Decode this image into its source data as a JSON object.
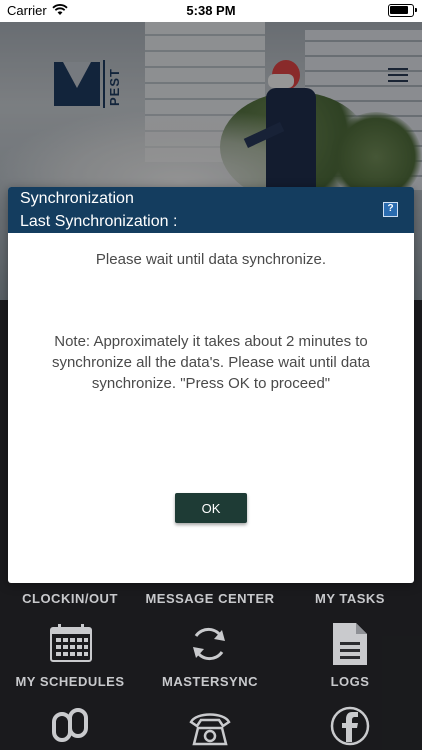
{
  "status_bar": {
    "carrier": "Carrier",
    "time": "5:38 PM"
  },
  "brand": {
    "logo_text": "PEST"
  },
  "menu": {
    "items": [
      {
        "label": "CLOCKIN/OUT"
      },
      {
        "label": "MESSAGE CENTER"
      },
      {
        "label": "MY TASKS"
      },
      {
        "label": "MY SCHEDULES"
      },
      {
        "label": "MASTERSYNC"
      },
      {
        "label": "LOGS"
      }
    ],
    "icons": [
      "calendar-icon",
      "sync-icon",
      "document-icon",
      "link-icon",
      "phone-icon",
      "facebook-icon"
    ]
  },
  "dialog": {
    "title": "Synchronization",
    "subtitle": "Last Synchronization :",
    "help_label": "?",
    "message": "Please wait until data synchronize.",
    "note": "Note: Approximately it takes about 2 minutes to synchronize all the data's. Please wait until data synchronize. \"Press OK to proceed\"",
    "ok_label": "OK"
  },
  "colors": {
    "dialog_header": "#143d5f",
    "ok_button": "#1e3b35",
    "background": "#2a2b2f"
  }
}
